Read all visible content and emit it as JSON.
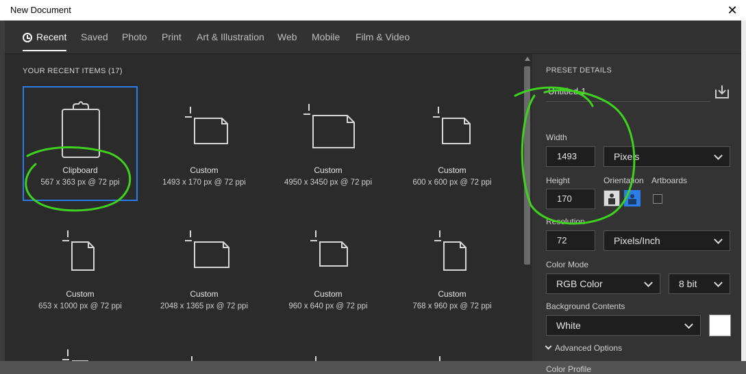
{
  "window": {
    "title": "New Document",
    "close_icon": "close-icon"
  },
  "tabs": [
    {
      "label": "Recent",
      "active": true,
      "icon": "clock-icon"
    },
    {
      "label": "Saved"
    },
    {
      "label": "Photo"
    },
    {
      "label": "Print"
    },
    {
      "label": "Art & Illustration"
    },
    {
      "label": "Web"
    },
    {
      "label": "Mobile"
    },
    {
      "label": "Film & Video"
    }
  ],
  "recent": {
    "title": "YOUR RECENT ITEMS",
    "count": "(17)",
    "items": [
      {
        "name": "Clipboard",
        "dims": "567 x 363 px @ 72 ppi",
        "icon": "clipboard-icon",
        "selected": true
      },
      {
        "name": "Custom",
        "dims": "1493 x 170 px @ 72 ppi",
        "icon": "landscape-doc-icon"
      },
      {
        "name": "Custom",
        "dims": "4950 x 3450 px @ 72 ppi",
        "icon": "landscape-doc-icon"
      },
      {
        "name": "Custom",
        "dims": "600 x 600 px @ 72 ppi",
        "icon": "square-doc-icon"
      },
      {
        "name": "Custom",
        "dims": "653 x 1000 px @ 72 ppi",
        "icon": "portrait-doc-icon"
      },
      {
        "name": "Custom",
        "dims": "2048 x 1365 px @ 72 ppi",
        "icon": "landscape-doc-icon"
      },
      {
        "name": "Custom",
        "dims": "960 x 640 px @ 72 ppi",
        "icon": "landscape-doc-icon"
      },
      {
        "name": "Custom",
        "dims": "768 x 960 px @ 72 ppi",
        "icon": "portrait-doc-icon"
      }
    ]
  },
  "preset": {
    "header": "PRESET DETAILS",
    "doc_name": "Untitled-1",
    "save_icon": "save-preset-icon",
    "width_label": "Width",
    "width_value": "1493",
    "width_unit": "Pixels",
    "height_label": "Height",
    "height_value": "170",
    "orientation_label": "Orientation",
    "artboards_label": "Artboards",
    "artboards_checked": false,
    "resolution_label": "Resolution",
    "resolution_value": "72",
    "resolution_unit": "Pixels/Inch",
    "color_mode_label": "Color Mode",
    "color_mode": "RGB Color",
    "bit_depth": "8 bit",
    "background_label": "Background Contents",
    "background": "White",
    "background_color": "#ffffff",
    "advanced_label": "Advanced Options",
    "color_profile_label": "Color Profile"
  },
  "colors": {
    "accent": "#2b7de9",
    "annotation": "#3fd21e"
  }
}
